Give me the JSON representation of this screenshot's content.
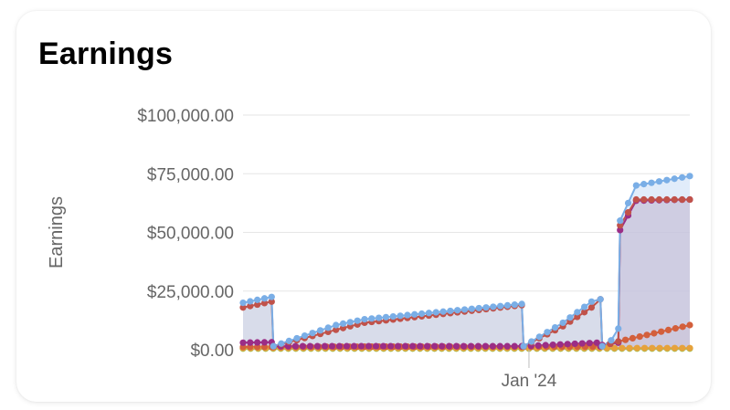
{
  "card": {
    "title": "Earnings"
  },
  "chart_data": {
    "type": "area",
    "title": "Earnings",
    "xlabel": "",
    "ylabel": "Earnings",
    "ylim": [
      0,
      100000
    ],
    "y_ticks": [
      0,
      25000,
      50000,
      75000,
      100000
    ],
    "y_tick_labels": [
      "$0.00",
      "$25,000.00",
      "$50,000.00",
      "$75,000.00",
      "$100,000.00"
    ],
    "x_range": [
      "2023-07-25",
      "2024-03-31"
    ],
    "x_ticks": [
      "2024-01-01"
    ],
    "x_tick_labels": [
      "Jan '24"
    ],
    "grid": true,
    "legend": "none",
    "stacked": true,
    "series": [
      {
        "color": "#8bc34a",
        "x": [
          "2023-07-25",
          "2023-09-01",
          "2023-11-01",
          "2024-01-01",
          "2024-02-01",
          "2024-03-31"
        ],
        "y": [
          500,
          500,
          500,
          500,
          500,
          500
        ]
      },
      {
        "color": "#e6a23c",
        "x": [
          "2023-07-25",
          "2023-09-01",
          "2023-11-01",
          "2024-01-01",
          "2024-02-01",
          "2024-03-31"
        ],
        "y": [
          700,
          700,
          700,
          700,
          700,
          700
        ]
      },
      {
        "color": "#d35f3c",
        "x": [
          "2023-07-25",
          "2023-08-10",
          "2023-08-11",
          "2023-10-01",
          "2023-12-28",
          "2023-12-29",
          "2024-02-10",
          "2024-02-11",
          "2024-02-20",
          "2024-03-31"
        ],
        "y": [
          1200,
          1200,
          1200,
          1300,
          1300,
          1300,
          1300,
          2000,
          3500,
          10500
        ]
      },
      {
        "color": "#9b2d86",
        "x": [
          "2023-07-25",
          "2023-08-10",
          "2023-08-11",
          "2023-11-01",
          "2023-12-28",
          "2023-12-29",
          "2024-02-08",
          "2024-02-10",
          "2024-02-11",
          "2024-02-20",
          "2024-02-21",
          "2024-03-01",
          "2024-03-31"
        ],
        "y": [
          3000,
          3200,
          1500,
          1500,
          1500,
          1500,
          3000,
          1500,
          2000,
          3000,
          51000,
          63500,
          64000
        ]
      },
      {
        "color": "#c0524a",
        "x": [
          "2023-07-25",
          "2023-08-10",
          "2023-08-11",
          "2023-09-15",
          "2023-10-01",
          "2023-12-28",
          "2023-12-29",
          "2024-01-20",
          "2024-02-05",
          "2024-02-10",
          "2024-02-11",
          "2024-02-20",
          "2024-02-21",
          "2024-03-01",
          "2024-03-31"
        ],
        "y": [
          18000,
          20500,
          1500,
          8500,
          11500,
          19000,
          1500,
          10000,
          18000,
          21500,
          1500,
          3500,
          53000,
          64000,
          64000
        ]
      },
      {
        "color": "#7aaee6",
        "x": [
          "2023-07-25",
          "2023-08-10",
          "2023-08-11",
          "2023-09-15",
          "2023-10-01",
          "2023-12-28",
          "2023-12-29",
          "2024-01-20",
          "2024-02-05",
          "2024-02-10",
          "2024-02-11",
          "2024-02-16",
          "2024-02-20",
          "2024-02-21",
          "2024-03-01",
          "2024-03-31"
        ],
        "y": [
          20000,
          22500,
          1500,
          10500,
          13000,
          19500,
          1500,
          11500,
          20500,
          21500,
          1500,
          4000,
          9000,
          55000,
          70000,
          74000
        ]
      }
    ]
  }
}
